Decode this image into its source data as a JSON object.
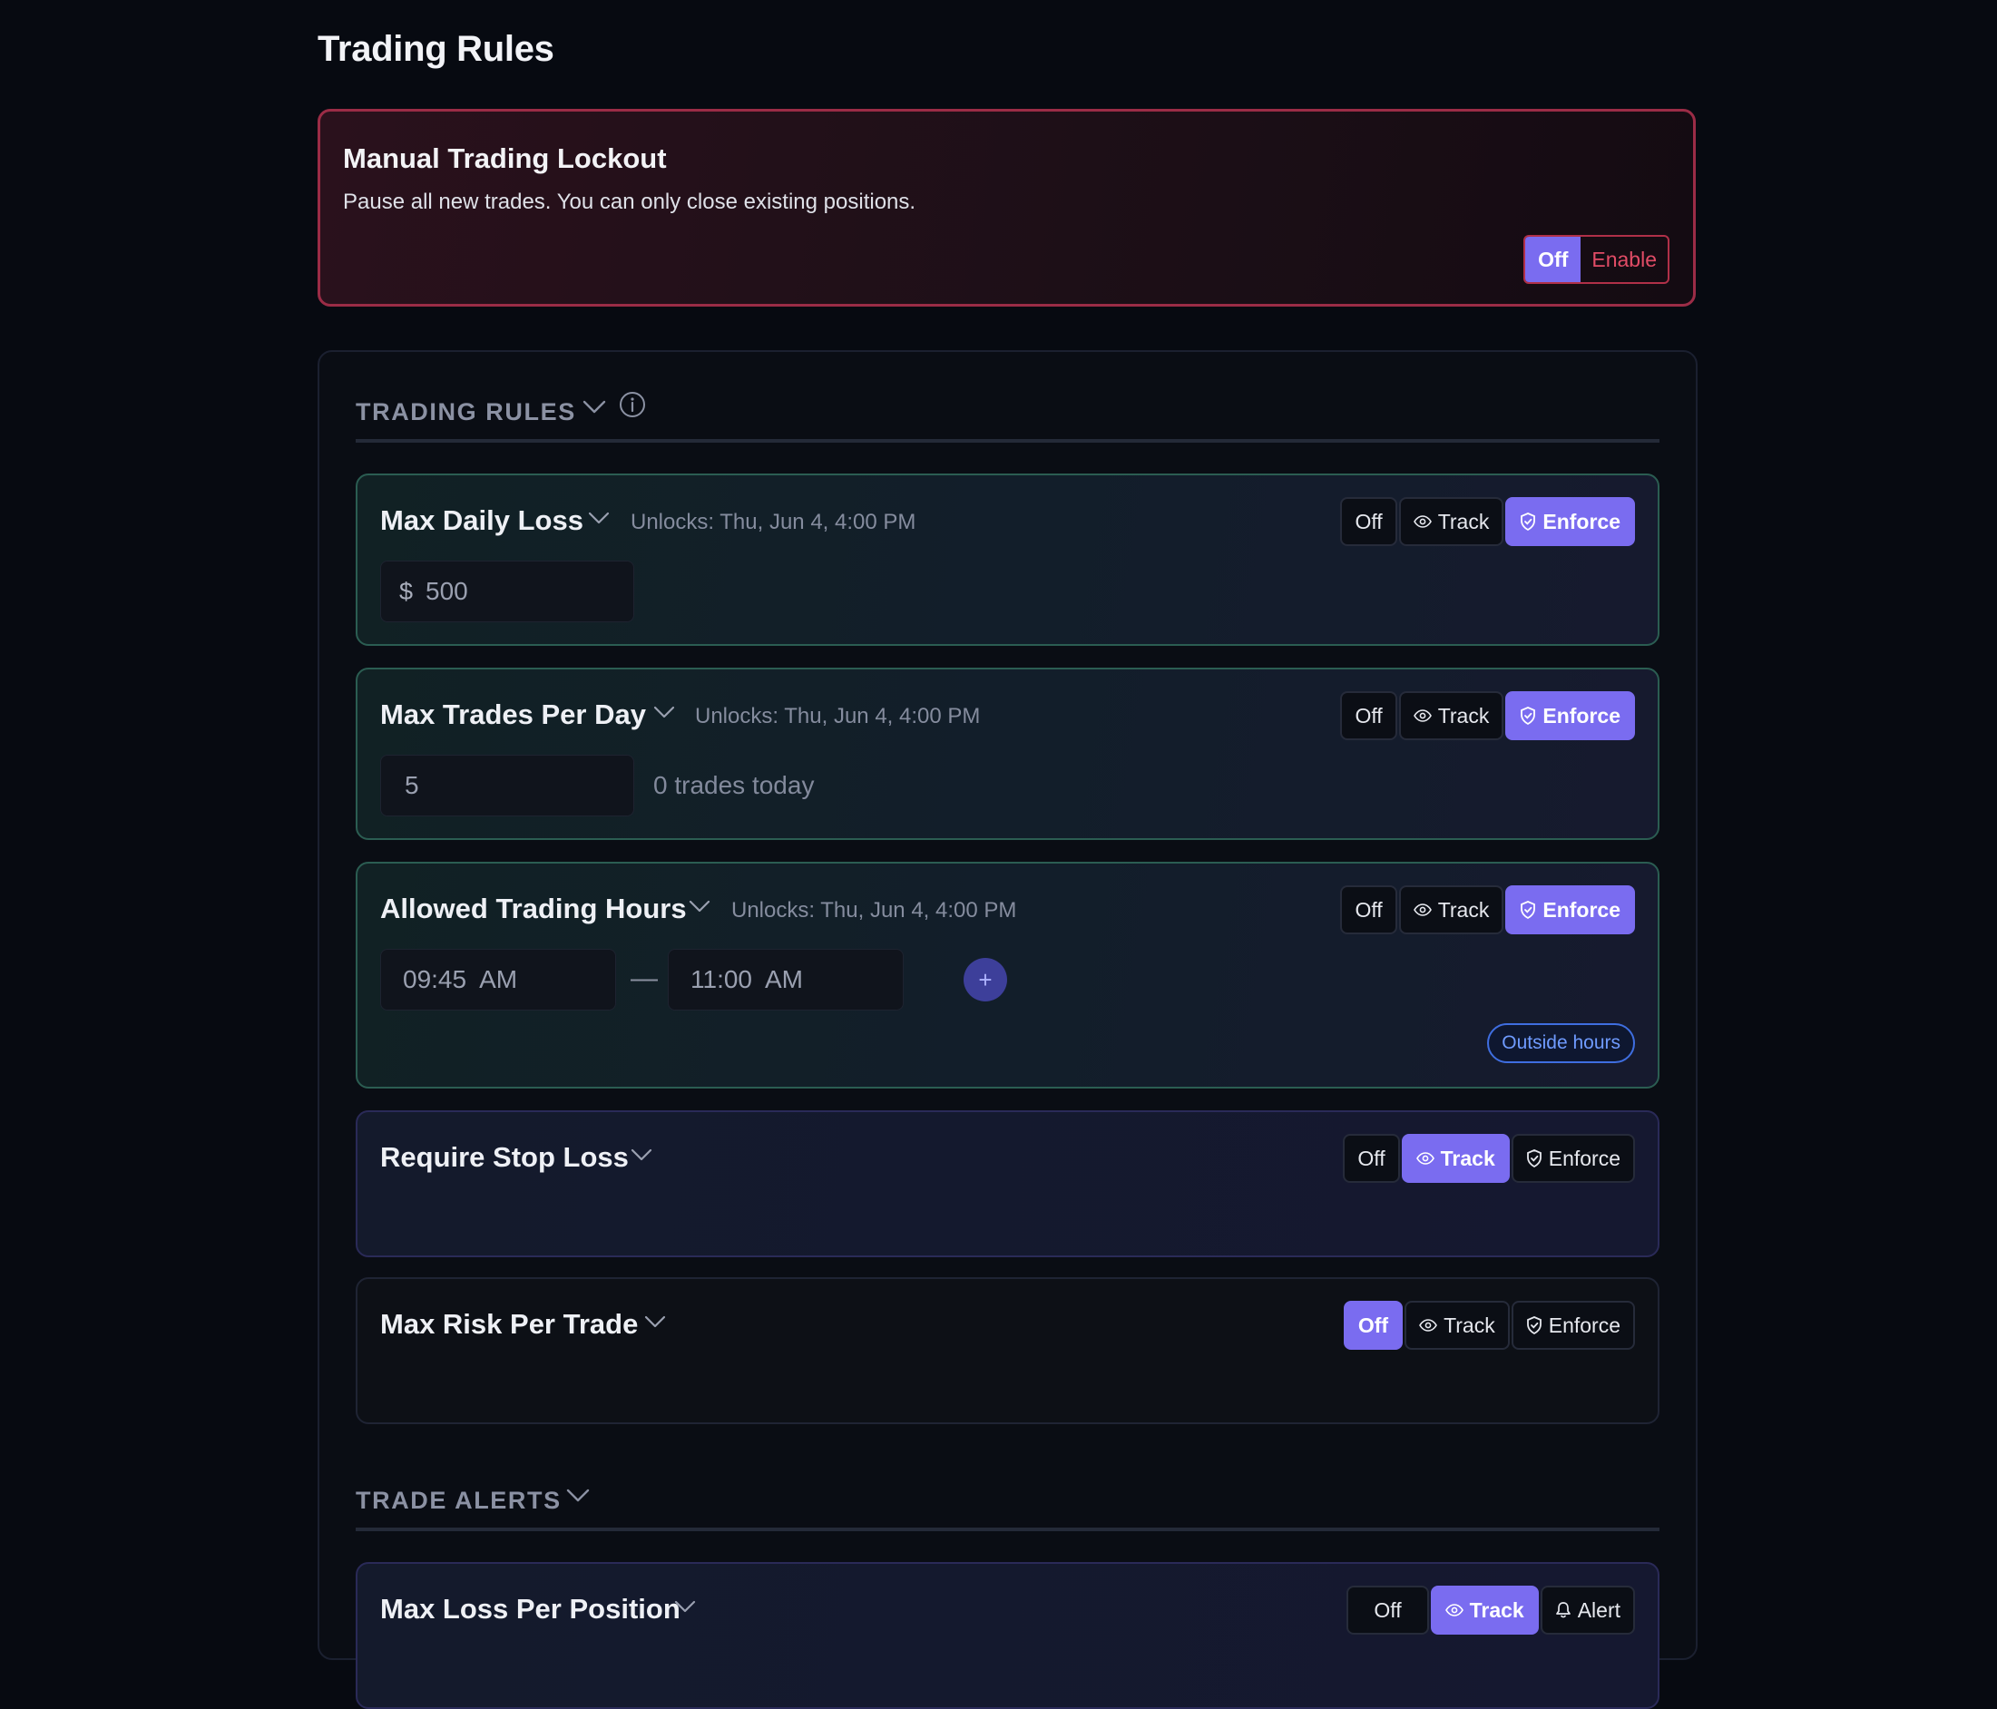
{
  "page": {
    "title": "Trading Rules"
  },
  "lockout": {
    "title": "Manual Trading Lockout",
    "description": "Pause all new trades. You can only close existing positions.",
    "off_label": "Off",
    "enable_label": "Enable",
    "state": "Off"
  },
  "sections": {
    "trading_rules": {
      "label": "TRADING RULES"
    },
    "trade_alerts": {
      "label": "TRADE ALERTS"
    }
  },
  "modes": {
    "off": "Off",
    "track": "Track",
    "enforce": "Enforce",
    "alert": "Alert"
  },
  "rules": {
    "max_daily_loss": {
      "title": "Max Daily Loss",
      "unlocks": "Unlocks: Thu, Jun 4, 4:00 PM",
      "currency": "$",
      "value": "500",
      "mode": "Enforce"
    },
    "max_trades": {
      "title": "Max Trades Per Day",
      "unlocks": "Unlocks: Thu, Jun 4, 4:00 PM",
      "value": "5",
      "note": "0 trades today",
      "mode": "Enforce"
    },
    "hours": {
      "title": "Allowed Trading Hours",
      "unlocks": "Unlocks: Thu, Jun 4, 4:00 PM",
      "start": "09:45  AM",
      "separator": "—",
      "end": "11:00  AM",
      "add": "+",
      "status": "Outside hours",
      "mode": "Enforce"
    },
    "stop_loss": {
      "title": "Require Stop Loss",
      "mode": "Track"
    },
    "max_risk": {
      "title": "Max Risk Per Trade",
      "mode": "Off"
    }
  },
  "alerts": {
    "max_loss_position": {
      "title": "Max Loss Per Position",
      "mode": "Track"
    }
  },
  "colors": {
    "accent": "#7a6cf0",
    "danger": "#e14c66",
    "info": "#3f6ee0"
  }
}
